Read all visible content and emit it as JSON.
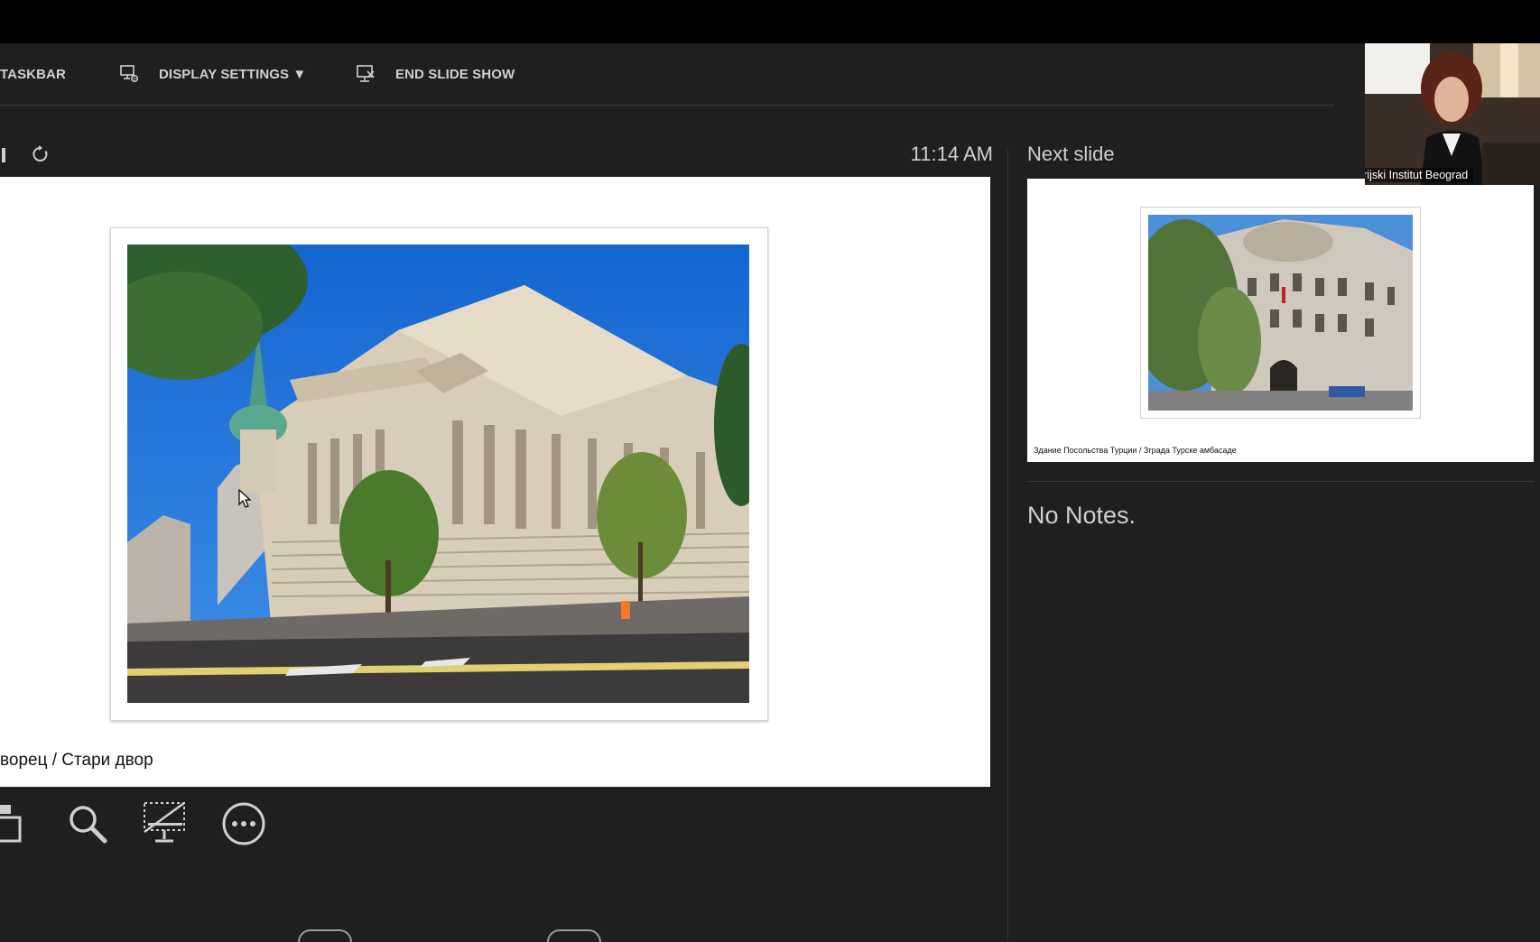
{
  "toolbar": {
    "taskbar_label": "TASKBAR",
    "display_settings_label": "DISPLAY SETTINGS ▼",
    "end_slide_show_label": "END SLIDE SHOW"
  },
  "presenter": {
    "time": "11:14 AM",
    "slide_caption": "ворец / Стари двор"
  },
  "next_slide": {
    "label": "Next slide",
    "caption": "Здание Посольства Турции / Зграда Турске амбасаде"
  },
  "notes": {
    "text": "No Notes."
  },
  "webcam": {
    "participant_name": "Istorijski Institut Beograd"
  },
  "icons": {
    "see_all_slides": "slides-grid-icon",
    "zoom": "magnifier-icon",
    "black_screen": "monitor-slash-icon",
    "more_options": "ellipsis-circle-icon",
    "display_settings": "monitor-gear-icon",
    "end_slide_show": "monitor-x-icon",
    "restart": "refresh-icon"
  },
  "colors": {
    "background": "#1f1f1f",
    "top_bar": "#000000",
    "text": "#d0d0d0"
  }
}
